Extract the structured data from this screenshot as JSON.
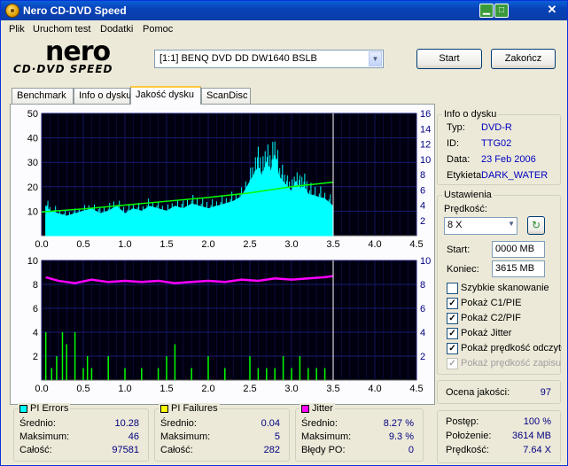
{
  "window": {
    "title": "Nero CD-DVD Speed"
  },
  "menu": [
    "Plik",
    "Uruchom test",
    "Dodatki",
    "Pomoc"
  ],
  "logo": {
    "brand": "nero",
    "product": "CD·DVD SPEED"
  },
  "drive": {
    "selected": "[1:1]  BENQ DVD DD DW1640 BSLB"
  },
  "buttons": {
    "start": "Start",
    "stop": "Zakończ"
  },
  "tabs": [
    "Benchmark",
    "Info o dysku",
    "Jakość dysku",
    "ScanDisc"
  ],
  "disc_info": {
    "title": "Info o dysku",
    "rows": [
      {
        "key": "Typ:",
        "value": "DVD-R"
      },
      {
        "key": "ID:",
        "value": "TTG02"
      },
      {
        "key": "Data:",
        "value": "23 Feb 2006"
      },
      {
        "key": "Etykieta",
        "value": "DARK_WATER"
      }
    ]
  },
  "settings": {
    "title": "Ustawienia",
    "speed_label": "Prędkość:",
    "speed_value": "8 X",
    "start_label": "Start:",
    "start_value": "0000 MB",
    "end_label": "Koniec:",
    "end_value": "3615 MB",
    "checks": [
      {
        "label": "Szybkie skanowanie",
        "checked": false,
        "disabled": false
      },
      {
        "label": "Pokaż C1/PIE",
        "checked": true,
        "disabled": false
      },
      {
        "label": "Pokaż C2/PIF",
        "checked": true,
        "disabled": false
      },
      {
        "label": "Pokaż Jitter",
        "checked": true,
        "disabled": false
      },
      {
        "label": "Pokaż prędkość odczytu",
        "checked": true,
        "disabled": false
      },
      {
        "label": "Pokaż prędkość zapisu",
        "checked": true,
        "disabled": true
      }
    ]
  },
  "quality": {
    "label": "Ocena jakości:",
    "value": "97"
  },
  "pi_errors": {
    "title": "PI Errors",
    "color": "#00ffff",
    "rows": [
      {
        "key": "Średnio:",
        "value": "10.28"
      },
      {
        "key": "Maksimum:",
        "value": "46"
      },
      {
        "key": "Całość:",
        "value": "97581"
      }
    ]
  },
  "pi_failures": {
    "title": "PI Failures",
    "color": "#ffff00",
    "rows": [
      {
        "key": "Średnio:",
        "value": "0.04"
      },
      {
        "key": "Maksimum:",
        "value": "5"
      },
      {
        "key": "Całość:",
        "value": "282"
      }
    ]
  },
  "jitter": {
    "title": "Jitter",
    "color": "#ff00ff",
    "rows": [
      {
        "key": "Średnio:",
        "value": "8.27 %"
      },
      {
        "key": "Maksimum:",
        "value": "9.3 %"
      },
      {
        "key": "Błędy PO:",
        "value": "0"
      }
    ]
  },
  "progress": {
    "rows": [
      {
        "key": "Postęp:",
        "value": "100 %"
      },
      {
        "key": "Położenie:",
        "value": "3614 MB"
      },
      {
        "key": "Prędkość:",
        "value": "7.64 X"
      }
    ]
  },
  "chart_data": [
    {
      "type": "area",
      "x_ticks": [
        "0.0",
        "0.5",
        "1.0",
        "1.5",
        "2.0",
        "2.5",
        "3.0",
        "3.5",
        "4.0",
        "4.5"
      ],
      "y_ticks_left": [
        "10",
        "20",
        "30",
        "40",
        "50"
      ],
      "y_ticks_right": [
        "2",
        "4",
        "6",
        "8",
        "10",
        "12",
        "14",
        "16"
      ],
      "ylim": [
        0,
        50
      ],
      "ylim_right": [
        0,
        16
      ],
      "xlim": [
        0,
        4.5
      ],
      "series": [
        {
          "color": "#00ffff",
          "x": [
            0.05,
            0.1,
            0.2,
            0.3,
            0.4,
            0.5,
            0.6,
            0.7,
            0.8,
            0.9,
            1.0,
            1.1,
            1.2,
            1.3,
            1.4,
            1.5,
            1.6,
            1.7,
            1.8,
            1.9,
            2.0,
            2.1,
            2.2,
            2.3,
            2.4,
            2.5,
            2.55,
            2.6,
            2.65,
            2.7,
            2.75,
            2.8,
            2.85,
            2.9,
            2.95,
            3.0,
            3.05,
            3.1,
            3.15,
            3.2,
            3.3,
            3.4,
            3.5
          ],
          "values": [
            12,
            10,
            9,
            8,
            9,
            10,
            11,
            9,
            10,
            12,
            9,
            11,
            10,
            12,
            11,
            10,
            12,
            11,
            13,
            12,
            11,
            12,
            13,
            14,
            16,
            22,
            25,
            28,
            24,
            30,
            26,
            33,
            24,
            22,
            20,
            18,
            22,
            19,
            20,
            17,
            16,
            15,
            12
          ]
        },
        {
          "color": "#00ff00",
          "axis": "right",
          "x": [
            0,
            0.5,
            1.0,
            1.5,
            2.0,
            2.5,
            3.0,
            3.5
          ],
          "values": [
            3.1,
            3.5,
            4.0,
            4.5,
            5.0,
            5.6,
            6.4,
            7.0
          ]
        }
      ],
      "marker_x": 3.5
    },
    {
      "type": "bar",
      "x_ticks": [
        "0.0",
        "0.5",
        "1.0",
        "1.5",
        "2.0",
        "2.5",
        "3.0",
        "3.5",
        "4.0",
        "4.5"
      ],
      "y_ticks_left": [
        "2",
        "4",
        "6",
        "8",
        "10"
      ],
      "y_ticks_right": [
        "2",
        "4",
        "6",
        "8",
        "10"
      ],
      "ylim": [
        0,
        10
      ],
      "ylim_right": [
        0,
        10
      ],
      "xlim": [
        0,
        4.5
      ],
      "series": [
        {
          "color": "#00ff00",
          "x": [
            0.05,
            0.12,
            0.18,
            0.25,
            0.3,
            0.4,
            0.5,
            0.55,
            0.6,
            0.8,
            1.0,
            1.2,
            1.4,
            1.5,
            1.6,
            1.8,
            2.0,
            2.2,
            2.5,
            2.6,
            2.7,
            2.8,
            2.9,
            3.0,
            3.1,
            3.2,
            3.3,
            3.4
          ],
          "values": [
            4,
            1,
            2,
            4,
            3,
            4,
            1,
            2,
            1,
            2,
            1,
            1,
            1,
            2,
            3,
            1,
            2,
            1,
            2,
            1,
            1,
            1,
            2,
            1,
            2,
            1,
            1,
            1
          ]
        },
        {
          "color": "#ff00ff",
          "axis": "right",
          "x": [
            0.05,
            0.2,
            0.4,
            0.6,
            0.8,
            1.0,
            1.2,
            1.4,
            1.6,
            1.8,
            2.0,
            2.2,
            2.4,
            2.6,
            2.8,
            3.0,
            3.2,
            3.4,
            3.5
          ],
          "values": [
            8.6,
            8.3,
            8.1,
            8.4,
            8.2,
            8.3,
            8.2,
            8.3,
            8.1,
            8.2,
            8.3,
            8.2,
            8.4,
            8.3,
            8.5,
            8.4,
            8.5,
            8.6,
            8.7
          ]
        }
      ],
      "marker_x": 3.5
    }
  ]
}
